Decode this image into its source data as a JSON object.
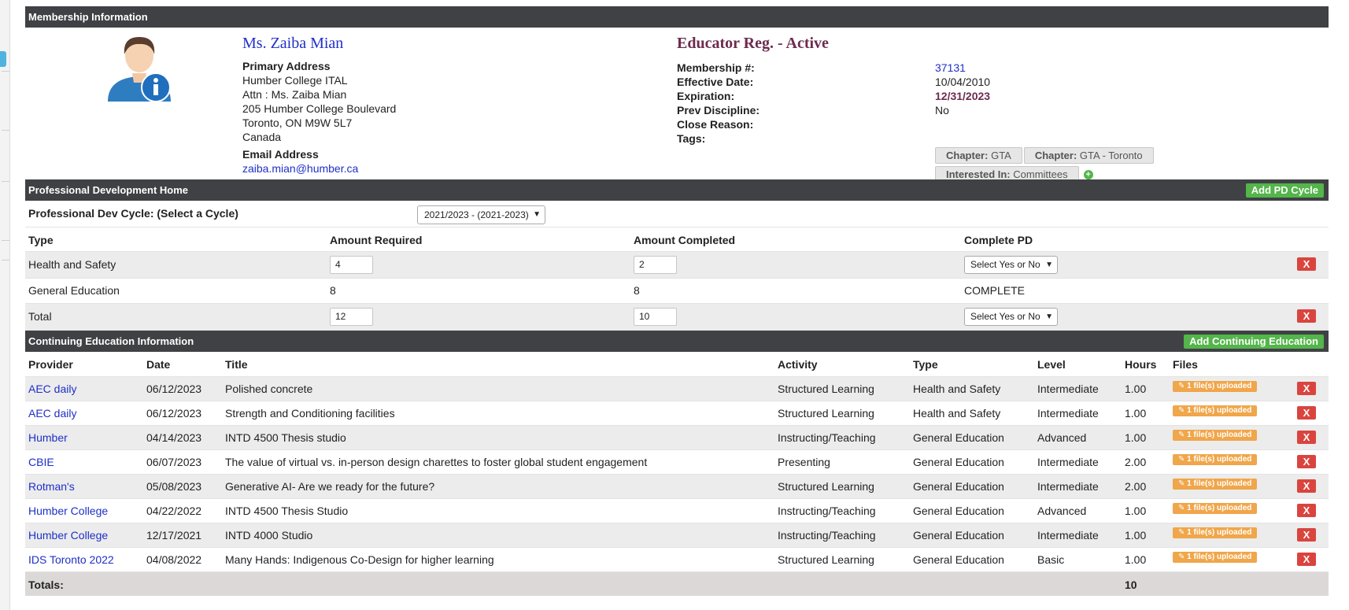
{
  "membership": {
    "section_title": "Membership Information",
    "name": "Ms. Zaiba Mian",
    "primary_address_label": "Primary Address",
    "address_lines": [
      "Humber College ITAL",
      "Attn : Ms. Zaiba Mian",
      "205 Humber College Boulevard",
      "Toronto, ON M9W 5L7",
      "Canada"
    ],
    "email_label": "Email Address",
    "email": "zaiba.mian@humber.ca",
    "status_title": "Educator Reg. - Active",
    "fields": {
      "membership_label": "Membership #:",
      "membership_value": "37131",
      "effective_label": "Effective Date:",
      "effective_value": "10/04/2010",
      "expiration_label": "Expiration:",
      "expiration_value": "12/31/2023",
      "discipline_label": "Prev Discipline:",
      "discipline_value": "No",
      "close_label": "Close Reason:",
      "close_value": "",
      "tags_label": "Tags:"
    },
    "tags": [
      {
        "key": "Chapter:",
        "value": "GTA"
      },
      {
        "key": "Chapter:",
        "value": "GTA - Toronto"
      },
      {
        "key": "Interested In:",
        "value": "Committees"
      }
    ]
  },
  "pd": {
    "section_title": "Professional Development Home",
    "add_button": "Add PD Cycle",
    "cycle_label": "Professional Dev Cycle: (Select a Cycle)",
    "cycle_selected": "2021/2023 - (2021-2023)",
    "headers": {
      "type": "Type",
      "required": "Amount Required",
      "completed": "Amount Completed",
      "complete_pd": "Complete PD"
    },
    "rows": [
      {
        "type": "Health and Safety",
        "required": "4",
        "completed": "2",
        "complete_pd": "Select Yes or No"
      },
      {
        "type": "General Education",
        "required": "8",
        "completed": "8",
        "complete_pd": "COMPLETE"
      },
      {
        "type": "Total",
        "required": "12",
        "completed": "10",
        "complete_pd": "Select Yes or No"
      }
    ],
    "delete_label": "X"
  },
  "ce": {
    "section_title": "Continuing Education Information",
    "add_button": "Add Continuing Education",
    "headers": {
      "provider": "Provider",
      "date": "Date",
      "title": "Title",
      "activity": "Activity",
      "type": "Type",
      "level": "Level",
      "hours": "Hours",
      "files": "Files"
    },
    "file_badge": "1 file(s) uploaded",
    "rows": [
      {
        "provider": "AEC daily",
        "date": "06/12/2023",
        "title": "Polished concrete",
        "activity": "Structured Learning",
        "type": "Health and Safety",
        "level": "Intermediate",
        "hours": "1.00"
      },
      {
        "provider": "AEC daily",
        "date": "06/12/2023",
        "title": "Strength and Conditioning facilities",
        "activity": "Structured Learning",
        "type": "Health and Safety",
        "level": "Intermediate",
        "hours": "1.00"
      },
      {
        "provider": "Humber",
        "date": "04/14/2023",
        "title": "INTD 4500 Thesis studio",
        "activity": "Instructing/Teaching",
        "type": "General Education",
        "level": "Advanced",
        "hours": "1.00"
      },
      {
        "provider": "CBIE",
        "date": "06/07/2023",
        "title": "The value of virtual vs. in-person design charettes to foster global student engagement",
        "activity": "Presenting",
        "type": "General Education",
        "level": "Intermediate",
        "hours": "2.00"
      },
      {
        "provider": "Rotman's",
        "date": "05/08/2023",
        "title": "Generative AI- Are we ready for the future?",
        "activity": "Structured Learning",
        "type": "General Education",
        "level": "Intermediate",
        "hours": "2.00"
      },
      {
        "provider": "Humber College",
        "date": "04/22/2022",
        "title": "INTD 4500 Thesis Studio",
        "activity": "Instructing/Teaching",
        "type": "General Education",
        "level": "Advanced",
        "hours": "1.00"
      },
      {
        "provider": "Humber College",
        "date": "12/17/2021",
        "title": "INTD 4000 Studio",
        "activity": "Instructing/Teaching",
        "type": "General Education",
        "level": "Intermediate",
        "hours": "1.00"
      },
      {
        "provider": "IDS Toronto 2022",
        "date": "04/08/2022",
        "title": "Many Hands: Indigenous Co-Design for higher learning",
        "activity": "Structured Learning",
        "type": "General Education",
        "level": "Basic",
        "hours": "1.00"
      }
    ],
    "totals_label": "Totals:",
    "totals_hours": "10"
  }
}
